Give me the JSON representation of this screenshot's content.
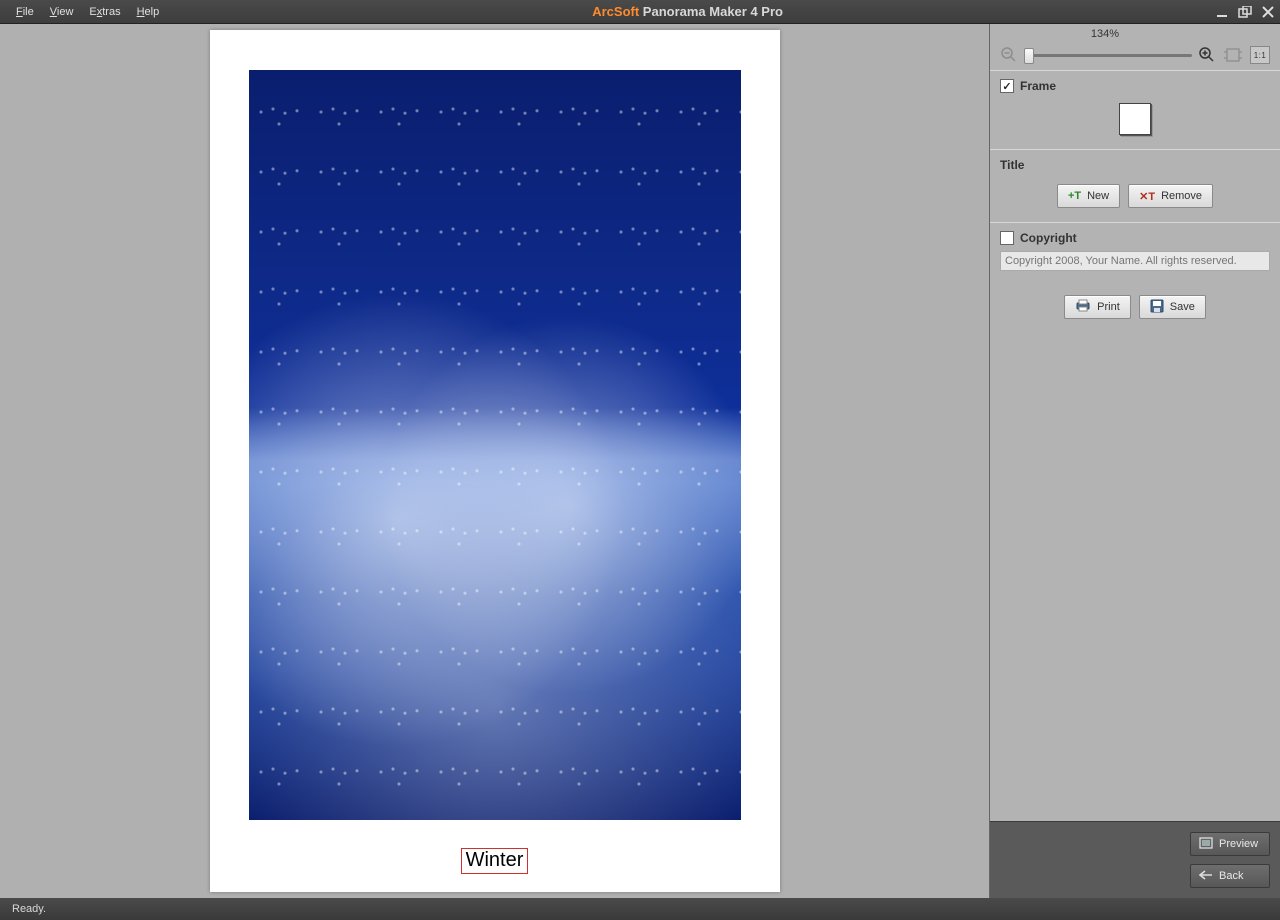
{
  "menubar": {
    "file": "File",
    "view": "View",
    "extras": "Extras",
    "help": "Help"
  },
  "window": {
    "brand": "ArcSoft",
    "title_rest": " Panorama Maker 4 Pro"
  },
  "zoom": {
    "percent": "134%"
  },
  "frame": {
    "label": "Frame",
    "checked": true
  },
  "title_section": {
    "label": "Title",
    "new_label": "New",
    "remove_label": "Remove"
  },
  "copyright": {
    "label": "Copyright",
    "placeholder": "Copyright 2008, Your Name. All rights reserved.",
    "checked": false
  },
  "actions": {
    "print": "Print",
    "save": "Save"
  },
  "nav": {
    "preview": "Preview",
    "back": "Back"
  },
  "document": {
    "title_text": "Winter"
  },
  "status": {
    "text": "Ready."
  }
}
